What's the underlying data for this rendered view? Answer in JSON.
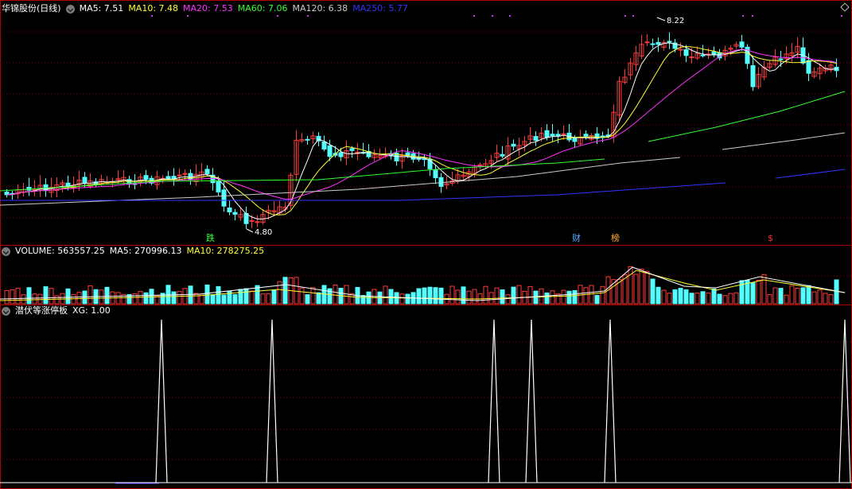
{
  "price_panel": {
    "title": "华锦股份(日线)",
    "indicators": [
      {
        "label": "MA5: 7.51",
        "color": "#ffffff"
      },
      {
        "label": "MA10: 7.48",
        "color": "#ffff33"
      },
      {
        "label": "MA20: 7.53",
        "color": "#ff33ff"
      },
      {
        "label": "MA60: 7.06",
        "color": "#33ff33"
      },
      {
        "label": "MA120: 6.38",
        "color": "#cccccc"
      },
      {
        "label": "MA250: 5.77",
        "color": "#3333ff"
      }
    ],
    "high_label": "8.22",
    "low_label": "4.80",
    "markers": {
      "die": "跌",
      "cai": "财",
      "bang": "榜",
      "dollar": "$"
    }
  },
  "volume_panel": {
    "indicators": [
      {
        "label": "VOLUME: 563557.25",
        "color": "#ffffff"
      },
      {
        "label": "MA5: 270996.13",
        "color": "#ffffff"
      },
      {
        "label": "MA10: 278275.25",
        "color": "#ffff33"
      }
    ]
  },
  "signal_panel": {
    "title": "潜伏等涨停板",
    "indicators": [
      {
        "label": "XG: 1.00",
        "color": "#ffffff"
      }
    ]
  },
  "colors": {
    "up": "#ff3a3a",
    "down": "#54ffff",
    "grid": "#8b0000",
    "border": "#b00000"
  }
}
